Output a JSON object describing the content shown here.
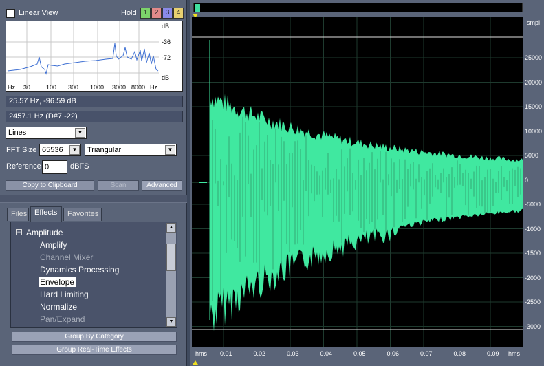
{
  "frequency_analysis": {
    "linear_view_label": "Linear View",
    "hold_label": "Hold",
    "hold_buttons": [
      {
        "label": "1",
        "color": "#7cd26a"
      },
      {
        "label": "2",
        "color": "#e28a8a"
      },
      {
        "label": "3",
        "color": "#8a8ae8"
      },
      {
        "label": "4",
        "color": "#e8d070"
      }
    ],
    "spectrum": {
      "db_top": "dB",
      "db_labels": [
        "-36",
        "-72"
      ],
      "db_bottom": "dB",
      "hz_left": "Hz",
      "freq_labels": [
        "30",
        "100",
        "300",
        "1000",
        "3000",
        "8000"
      ],
      "hz_right": "Hz"
    },
    "cursor_readout": "25.57 Hz, -96.59 dB",
    "peak_readout": "2457.1 Hz (D#7 -22)",
    "graph_type": "Lines",
    "fft_size_label": "FFT Size",
    "fft_size": "65536",
    "window": "Triangular",
    "reference_label": "Reference",
    "reference_value": "0",
    "reference_unit": "dBFS",
    "copy_button": "Copy to Clipboard",
    "scan_button": "Scan",
    "advanced_button": "Advanced"
  },
  "organizer": {
    "tabs": [
      "Files",
      "Effects",
      "Favorites"
    ],
    "active_tab": "Effects",
    "root": "Amplitude",
    "items": [
      {
        "label": "Amplify",
        "enabled": true
      },
      {
        "label": "Channel Mixer",
        "enabled": false
      },
      {
        "label": "Dynamics Processing",
        "enabled": true
      },
      {
        "label": "Envelope",
        "enabled": true,
        "selected": true
      },
      {
        "label": "Hard Limiting",
        "enabled": true
      },
      {
        "label": "Normalize",
        "enabled": true
      },
      {
        "label": "Pan/Expand",
        "enabled": false
      }
    ],
    "group_by_category": "Group By Category",
    "group_realtime": "Group Real-Time Effects"
  },
  "waveform": {
    "unit_label": "smpl",
    "amplitude_labels": [
      "25000",
      "20000",
      "15000",
      "10000",
      "5000",
      "0",
      "-5000",
      "-1000",
      "-1500",
      "-2000",
      "-2500",
      "-3000"
    ],
    "time_unit_left": "hms",
    "time_labels": [
      "0.01",
      "0.02",
      "0.03",
      "0.04",
      "0.05",
      "0.06",
      "0.07",
      "0.08",
      "0.09"
    ],
    "time_unit_right": "hms",
    "wave_color": "#40e8a0"
  }
}
